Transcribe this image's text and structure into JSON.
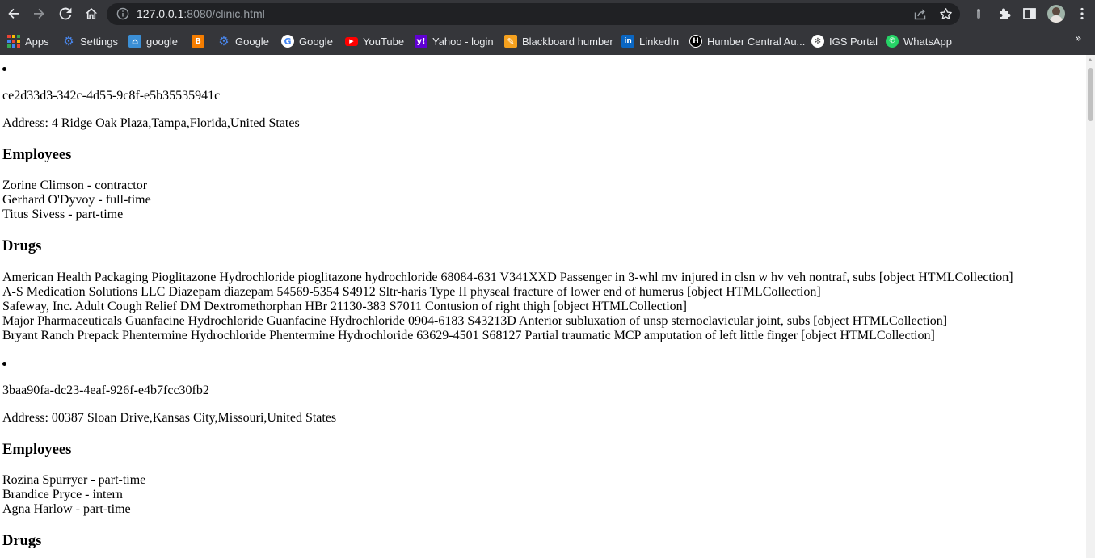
{
  "browser": {
    "url_host": "127.0.0.1",
    "url_rest": ":8080/clinic.html",
    "bookmarks": [
      {
        "label": "Apps",
        "icon": "apps-grid-icon",
        "color": "#ea4335"
      },
      {
        "label": "Settings",
        "icon": "gear-icon",
        "color": "#1a73e8"
      },
      {
        "label": "google",
        "icon": "home-icon",
        "color": "#1a88e8"
      },
      {
        "label": "",
        "icon": "blogger-icon",
        "color": "#f57d00"
      },
      {
        "label": "Google",
        "icon": "gear-icon",
        "color": "#1a73e8"
      },
      {
        "label": "Google",
        "icon": "google-g-icon",
        "color": "#ffffff"
      },
      {
        "label": "YouTube",
        "icon": "youtube-icon",
        "color": "#ff0000"
      },
      {
        "label": "Yahoo - login",
        "icon": "yahoo-icon",
        "color": "#6001d2"
      },
      {
        "label": "Blackboard humber",
        "icon": "pencil-icon",
        "color": "#f4a01e"
      },
      {
        "label": "LinkedIn",
        "icon": "linkedin-icon",
        "color": "#0a66c2"
      },
      {
        "label": "Humber Central Au...",
        "icon": "humber-icon",
        "color": "#000000"
      },
      {
        "label": "IGS Portal",
        "icon": "igs-globe-icon",
        "color": "#ffffff"
      },
      {
        "label": "WhatsApp",
        "icon": "whatsapp-icon",
        "color": "#25d366"
      }
    ]
  },
  "clinics": [
    {
      "id": "ce2d33d3-342c-4d55-9c8f-e5b35535941c",
      "address": "Address: 4 Ridge Oak Plaza,Tampa,Florida,United States",
      "employees_heading": "Employees",
      "employees": [
        "Zorine Climson - contractor",
        "Gerhard O'Dyvoy - full-time",
        "Titus Sivess - part-time"
      ],
      "drugs_heading": "Drugs",
      "drugs": [
        "American Health Packaging Pioglitazone Hydrochloride pioglitazone hydrochloride 68084-631 V341XXD Passenger in 3-whl mv injured in clsn w hv veh nontraf, subs [object HTMLCollection]",
        "A-S Medication Solutions LLC Diazepam diazepam 54569-5354 S4912 Sltr-haris Type II physeal fracture of lower end of humerus [object HTMLCollection]",
        "Safeway, Inc. Adult Cough Relief DM Dextromethorphan HBr 21130-383 S7011 Contusion of right thigh [object HTMLCollection]",
        "Major Pharmaceuticals Guanfacine Hydrochloride Guanfacine Hydrochloride 0904-6183 S43213D Anterior subluxation of unsp sternoclavicular joint, subs [object HTMLCollection]",
        "Bryant Ranch Prepack Phentermine Hydrochloride Phentermine Hydrochloride 63629-4501 S68127 Partial traumatic MCP amputation of left little finger [object HTMLCollection]"
      ]
    },
    {
      "id": "3baa90fa-dc23-4eaf-926f-e4b7fcc30fb2",
      "address": "Address: 00387 Sloan Drive,Kansas City,Missouri,United States",
      "employees_heading": "Employees",
      "employees": [
        "Rozina Spurryer - part-time",
        "Brandice Pryce - intern",
        "Agna Harlow - part-time"
      ],
      "drugs_heading": "Drugs",
      "drugs": []
    }
  ]
}
